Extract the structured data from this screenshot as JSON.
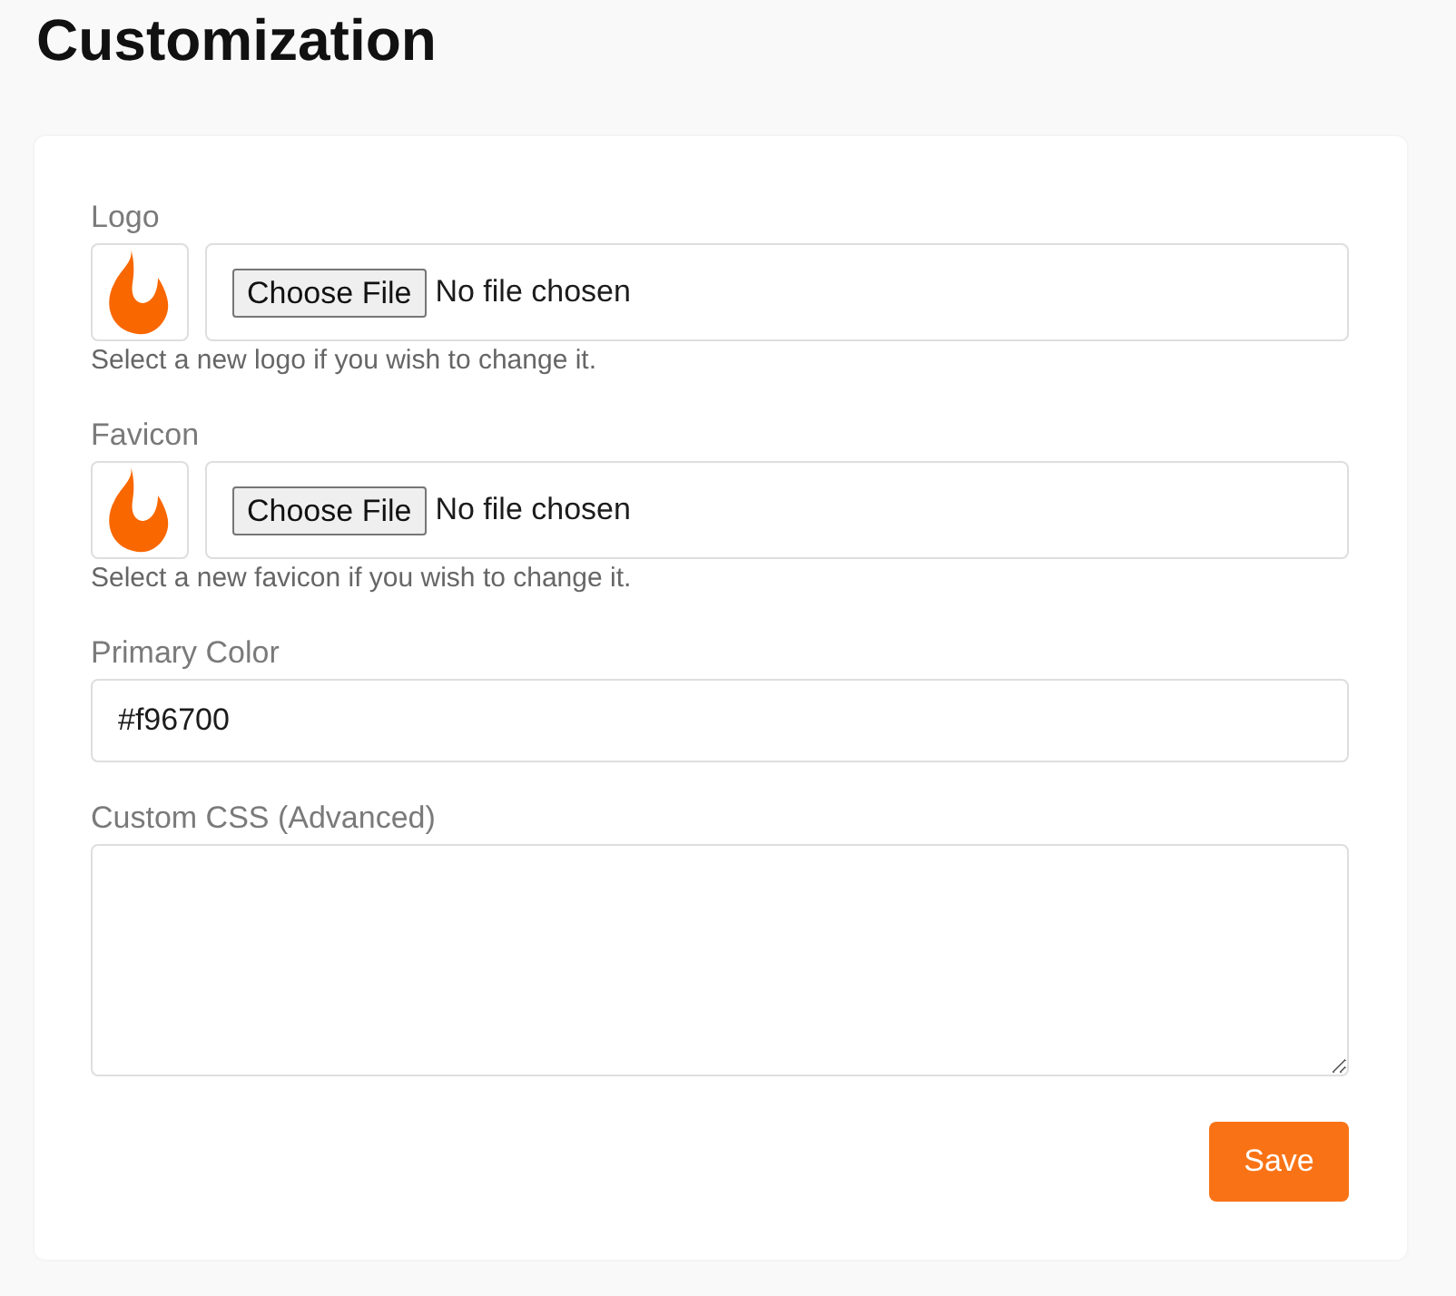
{
  "page": {
    "title": "Customization"
  },
  "form": {
    "fields": [
      {
        "kind": "file",
        "label": "Logo",
        "button": "Choose File",
        "status": "No file chosen",
        "help": "Select a new logo if you wish to change it."
      },
      {
        "kind": "file",
        "label": "Favicon",
        "button": "Choose File",
        "status": "No file chosen",
        "help": "Select a new favicon if you wish to change it."
      },
      {
        "kind": "text",
        "label": "Primary Color",
        "value": "#f96700"
      },
      {
        "kind": "textarea",
        "label": "Custom CSS (Advanced)"
      }
    ],
    "submit": "Save"
  }
}
